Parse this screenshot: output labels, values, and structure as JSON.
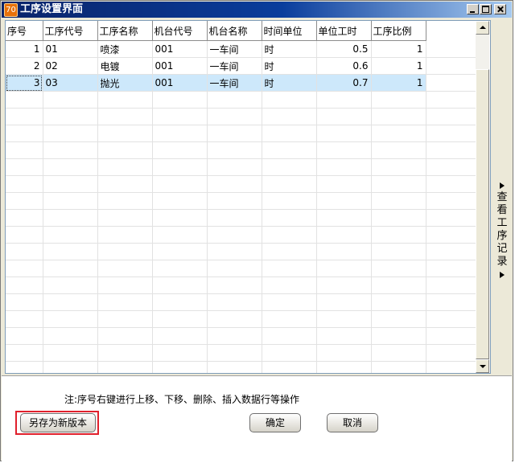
{
  "window": {
    "title": "工序设置界面",
    "app_icon_glyph": "70"
  },
  "grid": {
    "columns": [
      "序号",
      "工序代号",
      "工序名称",
      "机台代号",
      "机台名称",
      "时间单位",
      "单位工时",
      "工序比例"
    ],
    "rows": [
      {
        "seq": "1",
        "code": "01",
        "name": "喷漆",
        "machine_code": "001",
        "machine_name": "一车间",
        "time_unit": "时",
        "unit_hours": "0.5",
        "ratio": "1"
      },
      {
        "seq": "2",
        "code": "02",
        "name": "电镀",
        "machine_code": "001",
        "machine_name": "一车间",
        "time_unit": "时",
        "unit_hours": "0.6",
        "ratio": "1"
      },
      {
        "seq": "3",
        "code": "03",
        "name": "抛光",
        "machine_code": "001",
        "machine_name": "一车间",
        "time_unit": "时",
        "unit_hours": "0.7",
        "ratio": "1"
      }
    ],
    "selected_row": 3
  },
  "side_tab": {
    "label": "查看工序记录"
  },
  "bottom": {
    "note": "注:序号右键进行上移、下移、删除、插入数据行等操作",
    "save_as_new_version": "另存为新版本",
    "ok": "确定",
    "cancel": "取消"
  },
  "colors": {
    "selection": "#cde8fb",
    "highlight_border": "#e0202c",
    "title_bar": "#0a246a"
  }
}
